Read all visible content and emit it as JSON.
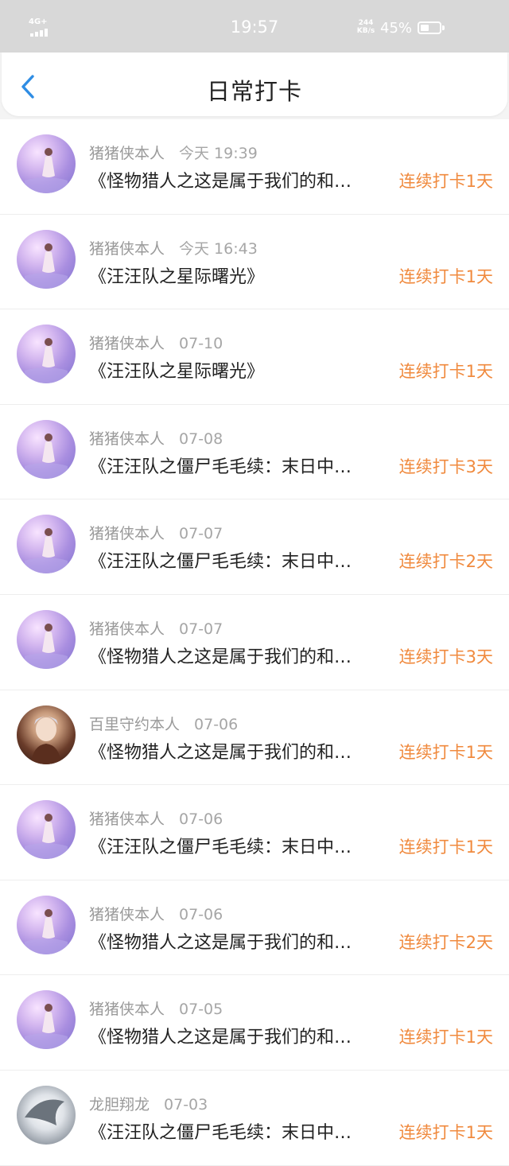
{
  "status_bar": {
    "network": "4G+",
    "time": "19:57",
    "speed_value": "244",
    "speed_unit": "KB/s",
    "battery_percent": "45%",
    "battery_level": 0.45
  },
  "header": {
    "back_icon": "chevron-left-icon",
    "title": "日常打卡",
    "accent_color": "#2f8de4"
  },
  "colors": {
    "streak": "#f08a3e",
    "name": "#9a9a9a",
    "title": "#222222"
  },
  "items": [
    {
      "avatar": "purple-girl-avatar",
      "name": "猪猪侠本人",
      "time": "今天 19:39",
      "title": "《怪物猎人之这是属于我们的和…",
      "streak": "连续打卡1天"
    },
    {
      "avatar": "purple-girl-avatar",
      "name": "猪猪侠本人",
      "time": "今天 16:43",
      "title": "《汪汪队之星际曙光》",
      "streak": "连续打卡1天"
    },
    {
      "avatar": "purple-girl-avatar",
      "name": "猪猪侠本人",
      "time": "07-10",
      "title": "《汪汪队之星际曙光》",
      "streak": "连续打卡1天"
    },
    {
      "avatar": "purple-girl-avatar",
      "name": "猪猪侠本人",
      "time": "07-08",
      "title": "《汪汪队之僵尸毛毛续：末日中…",
      "streak": "连续打卡3天"
    },
    {
      "avatar": "purple-girl-avatar",
      "name": "猪猪侠本人",
      "time": "07-07",
      "title": "《汪汪队之僵尸毛毛续：末日中…",
      "streak": "连续打卡2天"
    },
    {
      "avatar": "purple-girl-avatar",
      "name": "猪猪侠本人",
      "time": "07-07",
      "title": "《怪物猎人之这是属于我们的和…",
      "streak": "连续打卡3天"
    },
    {
      "avatar": "hero-avatar",
      "name": "百里守约本人",
      "time": "07-06",
      "title": "《怪物猎人之这是属于我们的和…",
      "streak": "连续打卡1天"
    },
    {
      "avatar": "purple-girl-avatar",
      "name": "猪猪侠本人",
      "time": "07-06",
      "title": "《汪汪队之僵尸毛毛续：末日中…",
      "streak": "连续打卡1天"
    },
    {
      "avatar": "purple-girl-avatar",
      "name": "猪猪侠本人",
      "time": "07-06",
      "title": "《怪物猎人之这是属于我们的和…",
      "streak": "连续打卡2天"
    },
    {
      "avatar": "purple-girl-avatar",
      "name": "猪猪侠本人",
      "time": "07-05",
      "title": "《怪物猎人之这是属于我们的和…",
      "streak": "连续打卡1天"
    },
    {
      "avatar": "dragon-avatar",
      "name": "龙胆翔龙",
      "time": "07-03",
      "title": "《汪汪队之僵尸毛毛续：末日中…",
      "streak": "连续打卡1天"
    }
  ]
}
